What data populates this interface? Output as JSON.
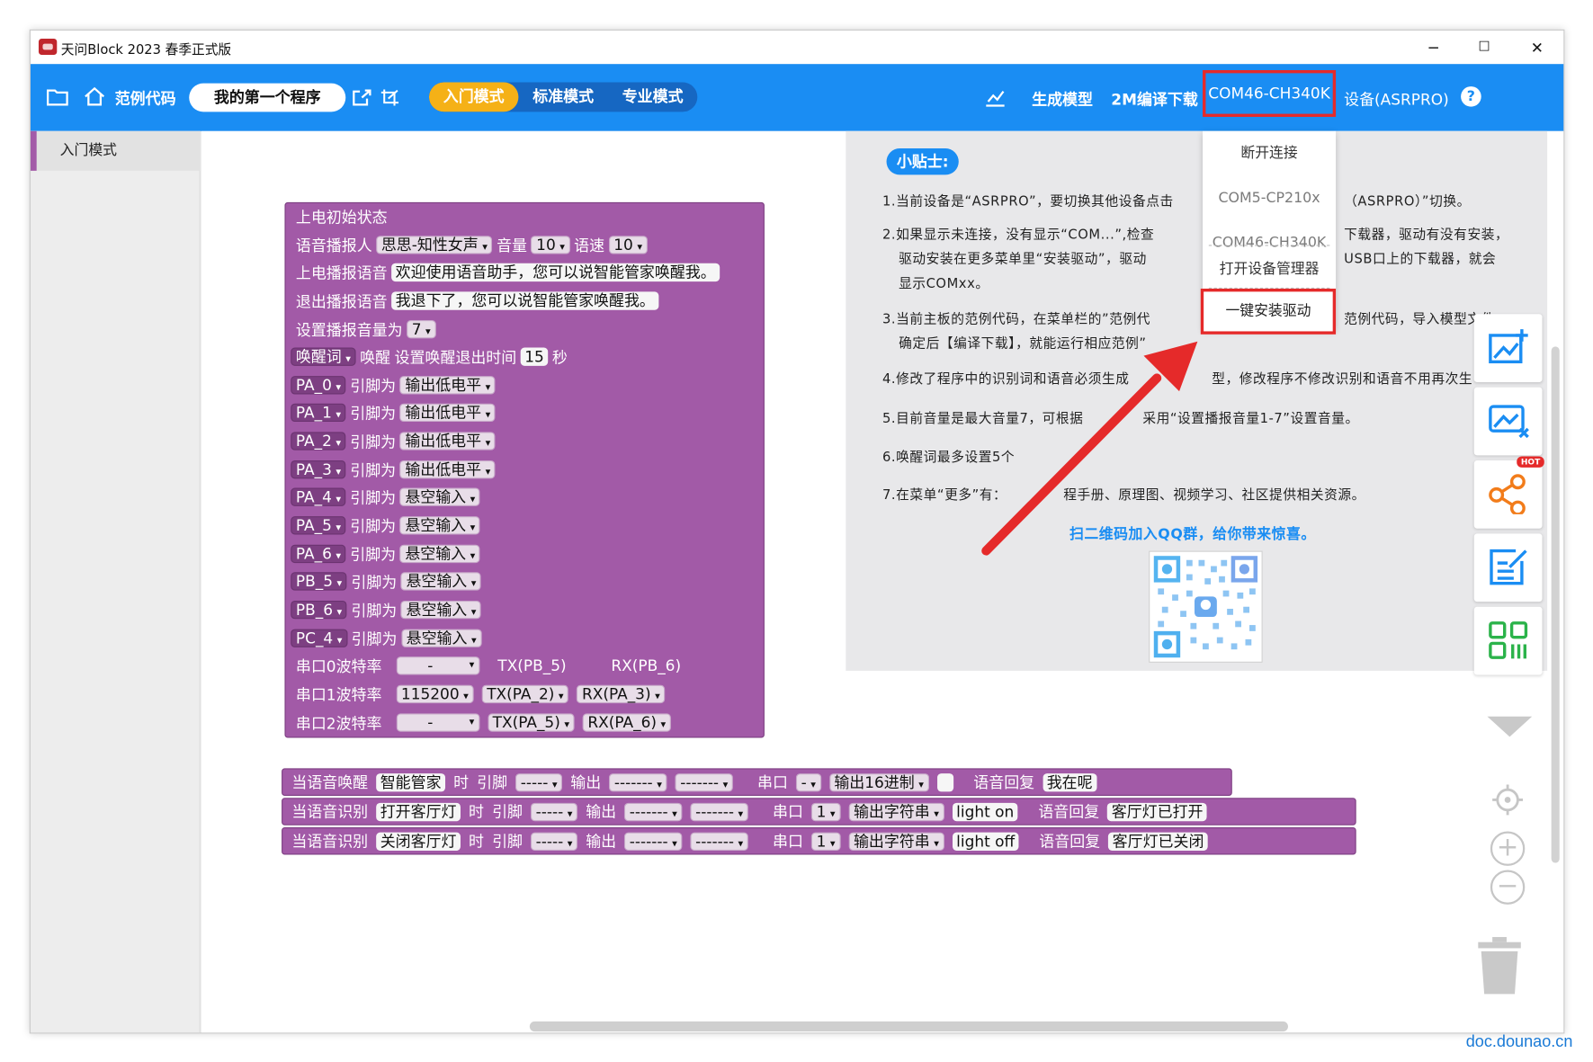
{
  "window": {
    "title": "天问Block 2023 春季正式版",
    "minimize": "─",
    "maximize": "☐",
    "close": "✕"
  },
  "toolbar": {
    "examples": "范例代码",
    "program_name": "我的第一个程序",
    "modes": [
      "入门模式",
      "标准模式",
      "专业模式"
    ],
    "active_mode": "入门模式",
    "generate_model": "生成模型",
    "compile_download": "2M编译下载",
    "com_port": "COM46-CH340K",
    "device": "设备(ASRPRO)",
    "help": "?"
  },
  "sidebar": {
    "items": [
      "入门模式"
    ]
  },
  "dropdown": {
    "items": [
      "断开连接",
      "COM5-CP210x",
      "COM46-CH340K",
      "打开设备管理器",
      "一键安装驱动"
    ]
  },
  "tips": {
    "title": "小贴士:",
    "lines": [
      "1.当前设备是“ASRPRO”，要切换其他设备点击",
      "（ASRPRO）”切换。",
      "2.如果显示未连接，没有显示“COM...”,检查",
      "下载器，驱动有没有安装，",
      "驱动安装在更多菜单里“安装驱动”，驱动",
      "USB口上的下载器，就会",
      "显示COMxx。",
      "3.当前主板的范例代码，在菜单栏的”范例代",
      "范例代码，导入模型文件",
      "确定后【编译下载】，就能运行相应范例”",
      "4.修改了程序中的识别词和语音必须生成",
      "型，修改程序不修改识别和语音不用再次生",
      "5.目前音量是最大音量7，可根据",
      "采用“设置播报音量1-7”设置音量。",
      "6.唤醒词最多设置5个",
      "7.在菜单“更多”有：",
      "程手册、原理图、视频学习、社区提供相关资源。"
    ],
    "cta": "扫二维码加入QQ群，给你带来惊喜。"
  },
  "init_block": {
    "title": "上电初始状态",
    "speaker_label": "语音播报人",
    "speaker": "思思-知性女声",
    "volume_label": "音量",
    "volume": "10",
    "speed_label": "语速",
    "speed": "10",
    "boot_label": "上电播报语音",
    "boot_text": "欢迎使用语音助手，您可以说智能管家唤醒我。",
    "exit_label": "退出播报语音",
    "exit_text": "我退下了，您可以说智能管家唤醒我。",
    "set_volume_label": "设置播报音量为",
    "set_volume": "7",
    "wake_word": "唤醒词",
    "wake_label": "唤醒",
    "wake_timeout_label": "设置唤醒退出时间",
    "wake_timeout": "15",
    "wake_timeout_unit": "秒",
    "pin_label": "引脚为",
    "pins": [
      {
        "pin": "PA_0",
        "mode": "输出低电平"
      },
      {
        "pin": "PA_1",
        "mode": "输出低电平"
      },
      {
        "pin": "PA_2",
        "mode": "输出低电平"
      },
      {
        "pin": "PA_3",
        "mode": "输出低电平"
      },
      {
        "pin": "PA_4",
        "mode": "悬空输入"
      },
      {
        "pin": "PA_5",
        "mode": "悬空输入"
      },
      {
        "pin": "PA_6",
        "mode": "悬空输入"
      },
      {
        "pin": "PB_5",
        "mode": "悬空输入"
      },
      {
        "pin": "PB_6",
        "mode": "悬空输入"
      },
      {
        "pin": "PC_4",
        "mode": "悬空输入"
      }
    ],
    "uarts": [
      {
        "label": "串口0波特率",
        "baud": "-",
        "tx": "TX(PB_5)",
        "rx": "RX(PB_6)"
      },
      {
        "label": "串口1波特率",
        "baud": "115200",
        "tx": "TX(PA_2)",
        "rx": "RX(PA_3)"
      },
      {
        "label": "串口2波特率",
        "baud": "-",
        "tx": "TX(PA_5)",
        "rx": "RX(PA_6)"
      }
    ]
  },
  "event_blocks": [
    {
      "event": "当语音唤醒",
      "word": "智能管家",
      "when": "时",
      "pin_label": "引脚",
      "pin": "-----",
      "out_label": "输出",
      "out1": "-------",
      "out2": "-------",
      "uart_label": "串口",
      "uart": "-",
      "uart_mode": "输出16进制",
      "data": "",
      "reply_label": "语音回复",
      "reply": "我在呢"
    },
    {
      "event": "当语音识别",
      "word": "打开客厅灯",
      "when": "时",
      "pin_label": "引脚",
      "pin": "-----",
      "out_label": "输出",
      "out1": "-------",
      "out2": "-------",
      "uart_label": "串口",
      "uart": "1",
      "uart_mode": "输出字符串",
      "data": "light on",
      "reply_label": "语音回复",
      "reply": "客厅灯已打开"
    },
    {
      "event": "当语音识别",
      "word": "关闭客厅灯",
      "when": "时",
      "pin_label": "引脚",
      "pin": "-----",
      "out_label": "输出",
      "out1": "-------",
      "out2": "-------",
      "uart_label": "串口",
      "uart": "1",
      "uart_mode": "输出字符串",
      "data": "light off",
      "reply_label": "语音回复",
      "reply": "客厅灯已关闭"
    }
  ],
  "tools": {
    "hot_badge": "HOT",
    "zoom_in": "+",
    "zoom_out": "−"
  },
  "watermark": "doc.dounao.cn",
  "colors": {
    "toolbar": "#1a8df3",
    "block": "#a25aa7",
    "highlight": "#e52a2a",
    "active_mode": "#f5b117"
  }
}
